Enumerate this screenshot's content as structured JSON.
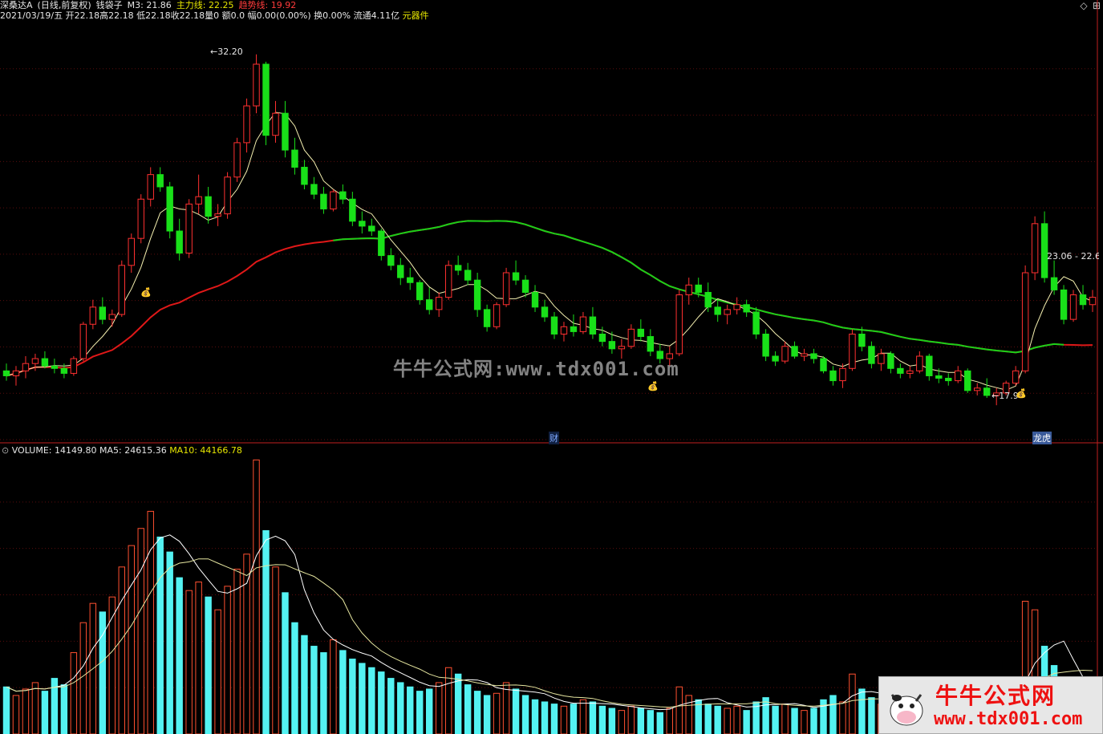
{
  "header": {
    "stock_name": "深桑达A",
    "period": "(日线,前复权)",
    "indicator_name": "钱袋子",
    "m3": "M3: 21.86",
    "main_line": "主力线: 22.25",
    "trend_line": "趋势线: 19.92",
    "date": "2021/03/19/五",
    "open": "开22.18",
    "high": "高22.18",
    "low": "低22.18",
    "close": "收22.18",
    "qty": "量0",
    "amount": "额0.0",
    "change": "幅0.00(0.00%)",
    "turnover": "换0.00%",
    "float": "流通4.11亿",
    "sector": "元器件"
  },
  "annotations": {
    "high_price": "32.20",
    "low_price": "17.9",
    "range_label": "23.06 - 22.6",
    "finance_tag": "财",
    "rank_tag": "龙虎"
  },
  "volume_header": {
    "volume": "VOLUME: 14149.80",
    "ma5": "MA5: 24615.36",
    "ma10": "MA10: 44166.78"
  },
  "watermark": {
    "center": "牛牛公式网:www.tdx001.com",
    "logo_cn": "牛牛公式网",
    "logo_url": "www.tdx001.com"
  },
  "colors": {
    "up": "#ff3030",
    "down": "#19e019",
    "highlight": "#ffe600",
    "volume_up": "#ff5030",
    "volume_down": "#54f2f2",
    "ma_fast": "#f5f0b0",
    "ma_slow": "#e01818",
    "trend": "#19d019"
  },
  "chart_data": {
    "type": "candlestick",
    "price_range": [
      16.5,
      33.5
    ],
    "volume_range": [
      0,
      130000
    ],
    "candles": [
      [
        19.3,
        19.6,
        18.9,
        19.1
      ],
      [
        19.1,
        19.5,
        18.7,
        19.3
      ],
      [
        19.3,
        19.9,
        19.0,
        19.6
      ],
      [
        19.6,
        20.0,
        19.3,
        19.8
      ],
      [
        19.8,
        20.1,
        19.4,
        19.5
      ],
      [
        19.5,
        19.8,
        19.2,
        19.4
      ],
      [
        19.4,
        19.6,
        19.0,
        19.2
      ],
      [
        19.2,
        19.9,
        19.1,
        19.8
      ],
      [
        19.8,
        21.3,
        19.7,
        21.2
      ],
      [
        21.2,
        22.2,
        21.0,
        21.9
      ],
      [
        21.9,
        22.3,
        21.2,
        21.4
      ],
      [
        21.4,
        21.8,
        21.1,
        21.6
      ],
      [
        21.6,
        23.8,
        21.5,
        23.6
      ],
      [
        23.6,
        24.9,
        23.3,
        24.7
      ],
      [
        24.7,
        26.5,
        24.5,
        26.3
      ],
      [
        26.3,
        27.6,
        26.0,
        27.3
      ],
      [
        27.3,
        27.6,
        26.6,
        26.8
      ],
      [
        26.8,
        27.0,
        24.7,
        25.0
      ],
      [
        25.0,
        25.5,
        23.8,
        24.1
      ],
      [
        24.1,
        26.3,
        23.9,
        26.1
      ],
      [
        26.1,
        27.3,
        25.7,
        26.4
      ],
      [
        26.4,
        26.8,
        25.3,
        25.6
      ],
      [
        25.6,
        26.1,
        25.2,
        25.7
      ],
      [
        25.7,
        27.4,
        25.5,
        27.2
      ],
      [
        27.2,
        28.8,
        27.0,
        28.6
      ],
      [
        28.6,
        30.4,
        28.2,
        30.1
      ],
      [
        30.1,
        32.2,
        29.8,
        31.8
      ],
      [
        31.8,
        31.9,
        28.5,
        28.9
      ],
      [
        28.9,
        30.3,
        28.6,
        29.8
      ],
      [
        29.8,
        30.3,
        28.0,
        28.3
      ],
      [
        28.3,
        28.8,
        27.3,
        27.6
      ],
      [
        27.6,
        27.9,
        26.7,
        26.9
      ],
      [
        26.9,
        27.2,
        26.3,
        26.5
      ],
      [
        26.5,
        26.8,
        25.7,
        25.9
      ],
      [
        25.9,
        26.7,
        25.8,
        26.6
      ],
      [
        26.6,
        26.9,
        26.1,
        26.3
      ],
      [
        26.3,
        26.6,
        25.2,
        25.4
      ],
      [
        25.4,
        25.8,
        24.9,
        25.2
      ],
      [
        25.2,
        25.5,
        24.8,
        25.0
      ],
      [
        25.0,
        25.1,
        23.8,
        24.0
      ],
      [
        24.0,
        24.3,
        23.4,
        23.6
      ],
      [
        23.6,
        23.9,
        22.8,
        23.1
      ],
      [
        23.1,
        23.5,
        22.6,
        22.9
      ],
      [
        22.9,
        23.0,
        22.0,
        22.2
      ],
      [
        22.2,
        22.7,
        21.6,
        21.8
      ],
      [
        21.8,
        22.5,
        21.5,
        22.3
      ],
      [
        22.3,
        23.8,
        22.2,
        23.6
      ],
      [
        23.6,
        24.0,
        23.2,
        23.4
      ],
      [
        23.4,
        23.7,
        22.8,
        23.0
      ],
      [
        23.0,
        23.3,
        21.5,
        21.8
      ],
      [
        21.8,
        22.0,
        20.9,
        21.1
      ],
      [
        21.1,
        22.1,
        21.0,
        22.0
      ],
      [
        22.0,
        23.5,
        21.9,
        23.3
      ],
      [
        23.3,
        23.8,
        22.8,
        23.0
      ],
      [
        23.0,
        23.2,
        22.3,
        22.5
      ],
      [
        22.5,
        22.8,
        21.7,
        21.9
      ],
      [
        21.9,
        22.2,
        21.3,
        21.5
      ],
      [
        21.5,
        21.7,
        20.6,
        20.8
      ],
      [
        20.8,
        21.3,
        20.5,
        21.1
      ],
      [
        21.1,
        21.6,
        20.7,
        20.9
      ],
      [
        20.9,
        21.7,
        20.8,
        21.5
      ],
      [
        21.5,
        21.9,
        20.6,
        20.8
      ],
      [
        20.8,
        21.1,
        20.3,
        20.5
      ],
      [
        20.5,
        20.9,
        20.0,
        20.2
      ],
      [
        20.2,
        20.6,
        19.8,
        20.3
      ],
      [
        20.3,
        21.2,
        20.2,
        21.0
      ],
      [
        21.0,
        21.4,
        20.5,
        20.7
      ],
      [
        20.7,
        21.0,
        19.9,
        20.1
      ],
      [
        20.1,
        20.4,
        19.6,
        19.8
      ],
      [
        19.8,
        20.3,
        19.5,
        20.0
      ],
      [
        20.0,
        22.6,
        19.9,
        22.4
      ],
      [
        22.4,
        23.1,
        22.0,
        22.8
      ],
      [
        22.8,
        23.1,
        22.3,
        22.5
      ],
      [
        22.5,
        22.9,
        21.7,
        21.9
      ],
      [
        21.9,
        22.2,
        21.3,
        21.6
      ],
      [
        21.6,
        22.0,
        21.2,
        21.8
      ],
      [
        21.8,
        22.3,
        21.6,
        22.0
      ],
      [
        22.0,
        22.2,
        21.5,
        21.7
      ],
      [
        21.7,
        21.9,
        20.6,
        20.8
      ],
      [
        20.8,
        21.0,
        19.7,
        19.9
      ],
      [
        19.9,
        20.1,
        19.5,
        19.7
      ],
      [
        19.7,
        20.5,
        19.6,
        20.3
      ],
      [
        20.3,
        20.5,
        19.8,
        19.9
      ],
      [
        19.9,
        20.2,
        19.7,
        20.0
      ],
      [
        20.0,
        20.2,
        19.6,
        19.8
      ],
      [
        19.8,
        19.9,
        19.2,
        19.3
      ],
      [
        19.3,
        19.5,
        18.7,
        18.9
      ],
      [
        18.9,
        19.6,
        18.6,
        19.4
      ],
      [
        19.4,
        21.0,
        19.3,
        20.8
      ],
      [
        20.8,
        21.1,
        20.1,
        20.3
      ],
      [
        20.3,
        20.5,
        19.4,
        19.6
      ],
      [
        19.6,
        20.2,
        19.3,
        20.0
      ],
      [
        20.0,
        20.1,
        19.2,
        19.4
      ],
      [
        19.4,
        19.6,
        19.0,
        19.2
      ],
      [
        19.2,
        19.5,
        19.0,
        19.3
      ],
      [
        19.3,
        20.1,
        19.2,
        19.9
      ],
      [
        19.9,
        20.0,
        18.9,
        19.1
      ],
      [
        19.1,
        19.4,
        18.8,
        19.0
      ],
      [
        19.0,
        19.2,
        18.7,
        18.9
      ],
      [
        18.9,
        19.5,
        18.8,
        19.3
      ],
      [
        19.3,
        19.4,
        18.4,
        18.5
      ],
      [
        18.5,
        18.8,
        18.3,
        18.6
      ],
      [
        18.6,
        19.0,
        18.2,
        18.3
      ],
      [
        18.3,
        18.6,
        17.9,
        18.4
      ],
      [
        18.4,
        18.9,
        18.3,
        18.8
      ],
      [
        18.8,
        19.5,
        18.7,
        19.3
      ],
      [
        19.3,
        23.6,
        19.2,
        23.3
      ],
      [
        23.3,
        25.6,
        23.0,
        25.3
      ],
      [
        25.3,
        25.8,
        22.9,
        23.1
      ],
      [
        23.1,
        23.8,
        22.4,
        22.6
      ],
      [
        22.6,
        22.8,
        21.2,
        21.4
      ],
      [
        21.4,
        22.6,
        21.3,
        22.4
      ],
      [
        22.4,
        22.8,
        21.8,
        22.0
      ],
      [
        22.0,
        22.6,
        21.7,
        22.3
      ]
    ],
    "volume": [
      22000,
      18000,
      21000,
      24000,
      20000,
      26000,
      23000,
      38000,
      52000,
      61000,
      57000,
      64000,
      78000,
      88000,
      96000,
      104000,
      92000,
      85000,
      73000,
      67000,
      71000,
      64000,
      58000,
      69000,
      77000,
      84000,
      128000,
      95000,
      78000,
      66000,
      52000,
      46000,
      41000,
      38000,
      44000,
      39000,
      35000,
      33000,
      31000,
      29000,
      26000,
      24000,
      22000,
      20000,
      21000,
      24000,
      31000,
      28000,
      23000,
      20000,
      18000,
      19000,
      24000,
      21000,
      18000,
      16000,
      15000,
      14000,
      13000,
      14000,
      16000,
      15000,
      13000,
      12000,
      11000,
      13000,
      12000,
      11000,
      10000,
      12000,
      22000,
      18000,
      16000,
      14000,
      13000,
      12000,
      13000,
      11000,
      15000,
      17000,
      13000,
      14000,
      12000,
      11000,
      12000,
      16000,
      18000,
      15000,
      28000,
      21000,
      17000,
      14000,
      13000,
      12000,
      11000,
      15000,
      16000,
      13000,
      12000,
      11000,
      18000,
      14000,
      13000,
      16000,
      14000,
      15000,
      62000,
      58000,
      41000,
      32000,
      24000,
      19000,
      17000,
      14150
    ]
  }
}
